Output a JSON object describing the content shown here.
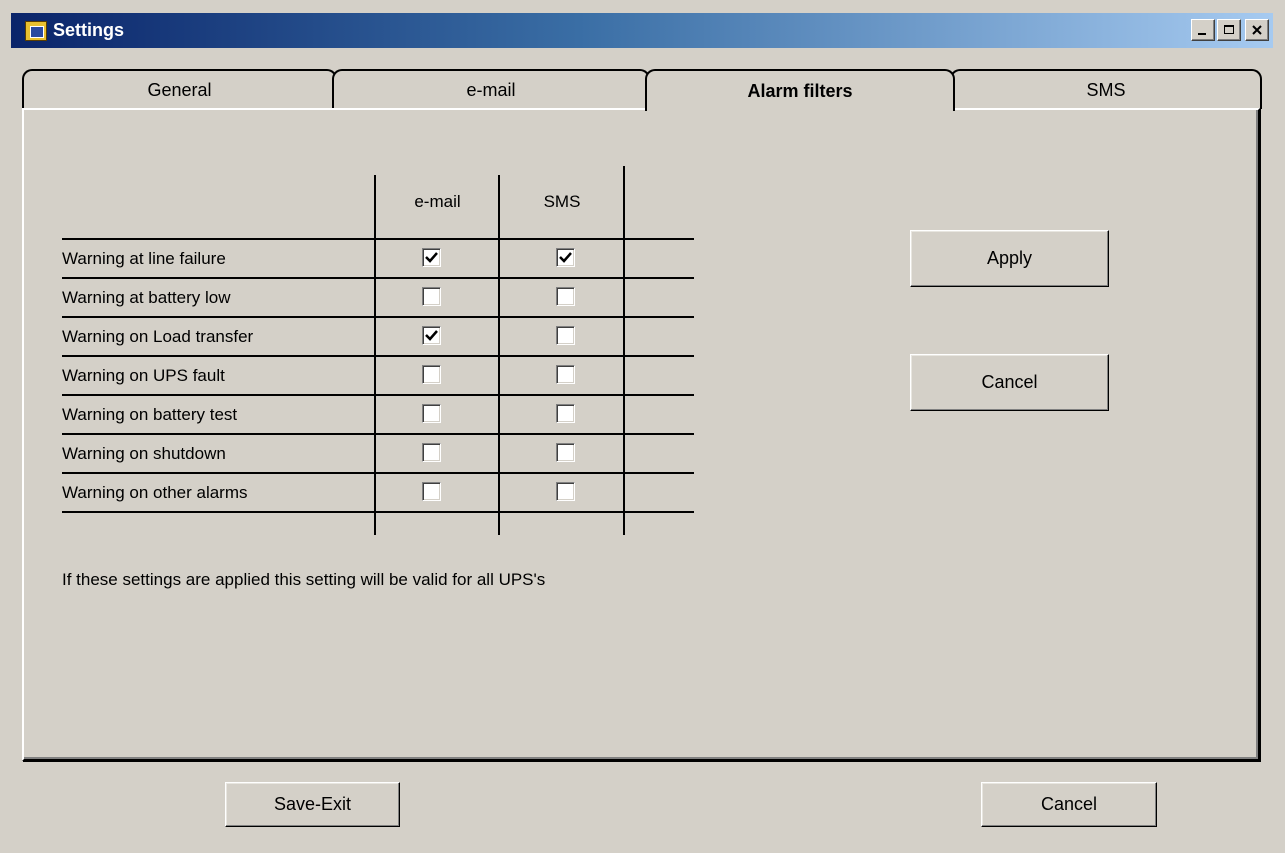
{
  "window": {
    "title": "Settings",
    "minimize_glyph": "_",
    "maximize_glyph": "□",
    "close_glyph": "×"
  },
  "tabs": [
    {
      "label": "General",
      "active": false
    },
    {
      "label": "e-mail",
      "active": false
    },
    {
      "label": "Alarm filters",
      "active": true
    },
    {
      "label": "SMS",
      "active": false
    }
  ],
  "filters": {
    "columns": [
      "e-mail",
      "SMS"
    ],
    "rows": [
      {
        "label": "Warning at line failure",
        "email": true,
        "sms": true
      },
      {
        "label": "Warning at battery low",
        "email": false,
        "sms": false
      },
      {
        "label": "Warning on Load transfer",
        "email": true,
        "sms": false
      },
      {
        "label": "Warning on UPS fault",
        "email": false,
        "sms": false
      },
      {
        "label": "Warning on battery test",
        "email": false,
        "sms": false
      },
      {
        "label": "Warning on shutdown",
        "email": false,
        "sms": false
      },
      {
        "label": "Warning on other alarms",
        "email": false,
        "sms": false
      }
    ],
    "note": "If these settings are applied this setting will be valid for all UPS's"
  },
  "panel_buttons": {
    "apply": "Apply",
    "cancel": "Cancel"
  },
  "footer": {
    "save_exit": "Save-Exit",
    "cancel": "Cancel"
  },
  "icons": {
    "title_icon": "settings-app-icon",
    "check": "checkmark-icon"
  }
}
